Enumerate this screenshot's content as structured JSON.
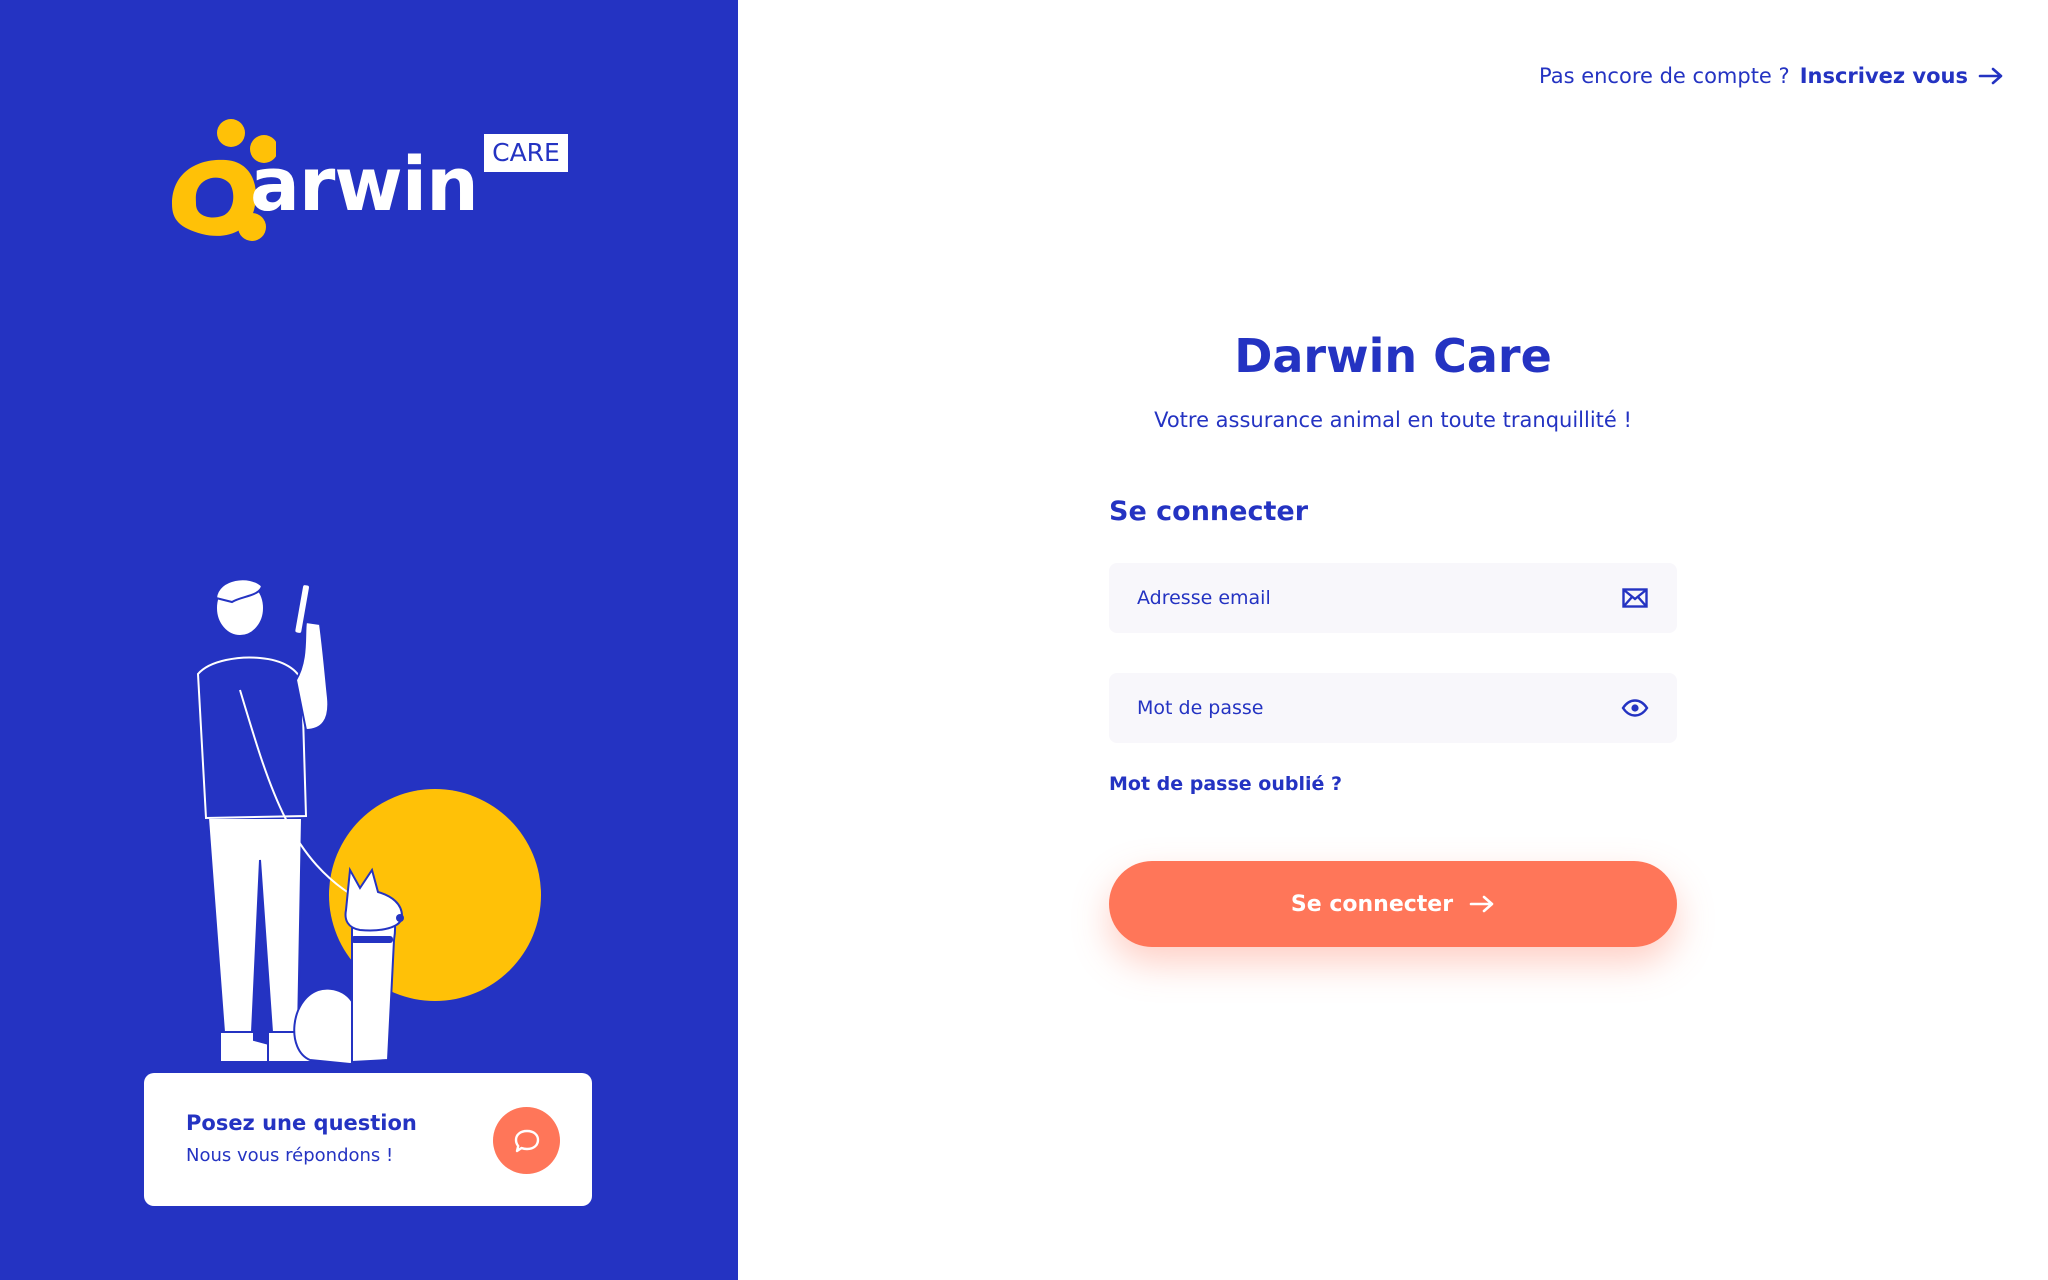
{
  "brand": {
    "logo_word": "arwin",
    "logo_badge": "CARE",
    "primary_color": "#2433c2",
    "accent_color": "#ff7659",
    "sun_color": "#ffc107"
  },
  "header": {
    "signup_prompt": "Pas encore de compte ?",
    "signup_link": "Inscrivez vous",
    "signup_icon": "arrow-right-icon"
  },
  "main": {
    "title": "Darwin Care",
    "subtitle": "Votre assurance animal en toute tranquillité !",
    "section_title": "Se connecter",
    "email": {
      "placeholder": "Adresse email",
      "value": "",
      "icon": "envelope-icon"
    },
    "password": {
      "placeholder": "Mot de passe",
      "value": "",
      "icon": "eye-icon"
    },
    "forgot_link": "Mot de passe oublié ?",
    "submit_label": "Se connecter",
    "submit_icon": "arrow-right-icon"
  },
  "help_card": {
    "title": "Posez une question",
    "subtitle": "Nous vous répondons !",
    "chat_icon": "chat-bubble-icon"
  }
}
